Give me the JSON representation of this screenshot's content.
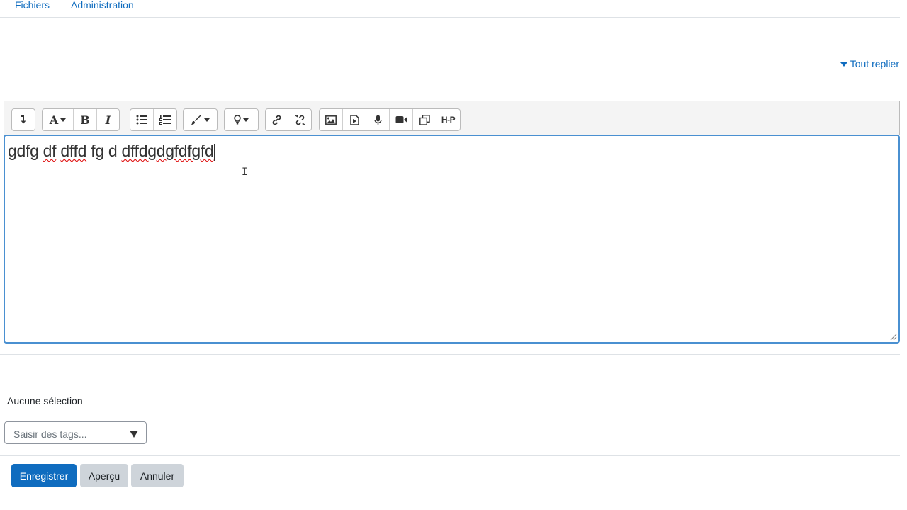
{
  "nav": {
    "files": "Fichiers",
    "admin": "Administration"
  },
  "collapse_all": "Tout replier",
  "toolbar": {
    "groups": [
      [
        "collapse-icon"
      ],
      [
        "font-style-icon",
        "bold-icon",
        "italic-icon"
      ],
      [
        "unordered-list-icon",
        "ordered-list-icon"
      ],
      [
        "paint-brush-icon"
      ],
      [
        "lightbulb-icon"
      ],
      [
        "link-icon",
        "unlink-icon"
      ],
      [
        "image-icon",
        "media-icon",
        "microphone-icon",
        "video-icon",
        "manage-files-icon",
        "h5p-icon"
      ]
    ],
    "glyphs": {
      "font": "A",
      "bold": "B",
      "italic": "I",
      "h5p": "H-P"
    }
  },
  "editor": {
    "words": [
      "gdfg",
      "df",
      "dffd",
      "fg",
      "d",
      "dffdgdgfdfgfd"
    ],
    "misspelled": [
      false,
      true,
      true,
      false,
      false,
      true
    ]
  },
  "tags": {
    "label": "Aucune sélection",
    "placeholder": "Saisir des tags..."
  },
  "buttons": {
    "save": "Enregistrer",
    "preview": "Aperçu",
    "cancel": "Annuler"
  },
  "colors": {
    "primary": "#0f6cbf",
    "secondary": "#ced4da",
    "focus": "#4a90d1"
  }
}
